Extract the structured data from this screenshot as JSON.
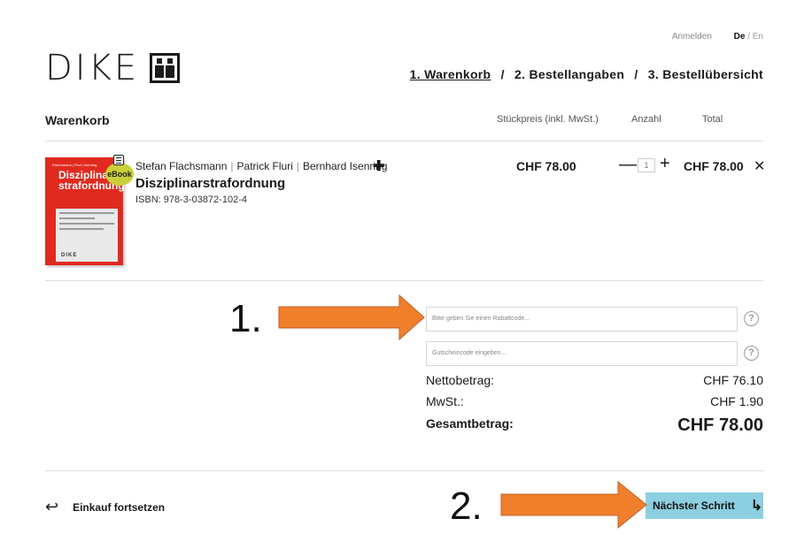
{
  "header": {
    "login_label": "Anmelden",
    "lang_de": "De",
    "lang_sep": "/",
    "lang_en": "En",
    "logo_text": "DIKE"
  },
  "steps": {
    "step1": "1. Warenkorb",
    "step2": "2. Bestellangaben",
    "step3": "3. Bestellübersicht",
    "separator": "/"
  },
  "cart": {
    "title": "Warenkorb",
    "col_price": "Stückpreis (inkl. MwSt.)",
    "col_qty": "Anzahl",
    "col_total": "Total"
  },
  "item": {
    "authors": [
      "Stefan Flachsmann",
      "Patrick Fluri",
      "Bernhard Isenring"
    ],
    "author_sep": "|",
    "title": "Disziplinarstrafordnung",
    "isbn": "ISBN: 978-3-03872-102-4",
    "badge": "eBook",
    "cover_authors": "Flachsmann | Fluri | Isenring",
    "cover_title_1": "Disziplinar-",
    "cover_title_2": "strafordnung",
    "cover_publisher": "DIKE",
    "price": "CHF 78.00",
    "quantity": "1",
    "line_total": "CHF 78.00"
  },
  "discount": {
    "coupon_placeholder": "Bitte geben Sie einen Rabattcode...",
    "voucher_placeholder": "Gutscheincode eingeben..."
  },
  "summary": {
    "net_label": "Nettobetrag:",
    "net_value": "CHF 76.10",
    "vat_label": "MwSt.:",
    "vat_value": "CHF 1.90",
    "total_label": "Gesamtbetrag:",
    "total_value": "CHF 78.00"
  },
  "footer": {
    "continue_label": "Einkauf fortsetzen",
    "next_label": "Nächster Schritt"
  },
  "annotations": {
    "marker1": "1.",
    "marker2": "2."
  },
  "colors": {
    "accent_button": "#8ccfe0",
    "annotation_arrow": "#f07f2c",
    "cover_red": "#e02a1f",
    "ebook_badge": "#c9cf3a"
  }
}
